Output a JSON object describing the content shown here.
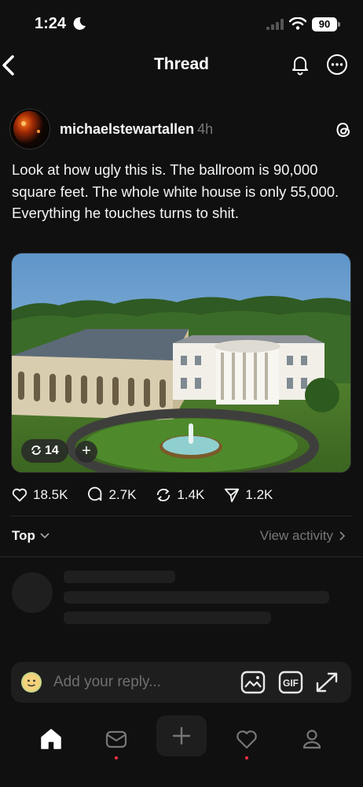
{
  "status_bar": {
    "time": "1:24",
    "battery": "90"
  },
  "header": {
    "title": "Thread"
  },
  "post": {
    "username": "michaelstewartallen",
    "time": "4h",
    "text": "Look at how ugly this is. The ballroom is 90,000 square feet. The whole white house is only 55,000. Everything he touches turns to shit.",
    "repost_chip_count": "14",
    "add_chip_label": "+",
    "likes": "18.5K",
    "comments": "2.7K",
    "reposts": "1.4K",
    "shares": "1.2K"
  },
  "replies": {
    "sort_label": "Top",
    "view_activity": "View activity"
  },
  "reply_bar": {
    "placeholder": "Add your reply...",
    "gif_label": "GIF"
  },
  "colors": {
    "background": "#101010",
    "notification_dot": "#ff3040",
    "muted_text": "#777777"
  },
  "icons": [
    "back-chevron-icon",
    "bell-icon",
    "more-icon",
    "threads-logo-icon",
    "heart-icon",
    "comment-icon",
    "repost-icon",
    "share-icon",
    "chevron-down-icon",
    "chevron-right-icon",
    "image-icon",
    "gif-icon",
    "expand-icon",
    "home-icon",
    "inbox-icon",
    "plus-icon",
    "heart-icon",
    "profile-icon"
  ]
}
